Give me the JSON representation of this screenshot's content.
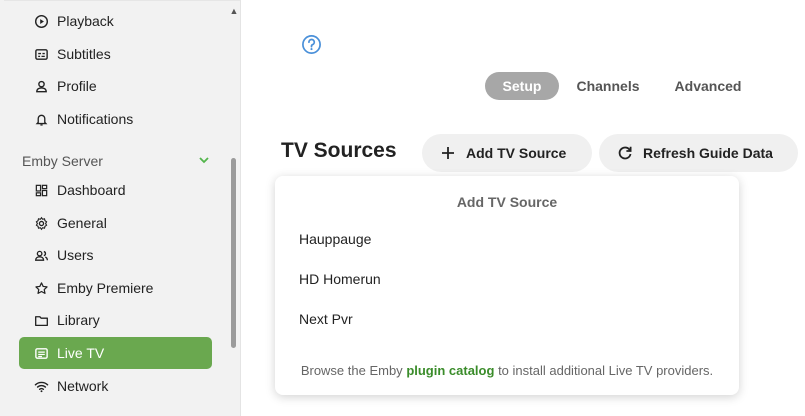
{
  "sidebar": {
    "items_top": [
      {
        "label": "Playback",
        "icon": "play-circle-icon"
      },
      {
        "label": "Subtitles",
        "icon": "subtitles-icon"
      },
      {
        "label": "Profile",
        "icon": "person-icon"
      },
      {
        "label": "Notifications",
        "icon": "bell-icon"
      }
    ],
    "section_label": "Emby Server",
    "items_server": [
      {
        "label": "Dashboard",
        "icon": "dashboard-icon"
      },
      {
        "label": "General",
        "icon": "gear-icon"
      },
      {
        "label": "Users",
        "icon": "users-icon"
      },
      {
        "label": "Emby Premiere",
        "icon": "star-icon"
      },
      {
        "label": "Library",
        "icon": "folder-icon"
      },
      {
        "label": "Live TV",
        "icon": "tv-guide-icon",
        "active": true
      },
      {
        "label": "Network",
        "icon": "wifi-icon"
      }
    ]
  },
  "tabs": [
    {
      "label": "Setup",
      "active": true
    },
    {
      "label": "Channels"
    },
    {
      "label": "Advanced"
    }
  ],
  "page_title": "TV Sources",
  "buttons": {
    "add_source": "Add TV Source",
    "refresh_guide": "Refresh Guide Data"
  },
  "dropdown": {
    "title": "Add TV Source",
    "items": [
      "Hauppauge",
      "HD Homerun",
      "Next Pvr"
    ],
    "footer_pre": "Browse the Emby",
    "footer_link": "plugin catalog",
    "footer_post": "to install additional Live TV providers."
  },
  "colors": {
    "accent_green": "#6aa84f",
    "link_green": "#3a8c2a",
    "help_blue": "#4a90d9",
    "tab_active": "#a7a7a7"
  }
}
